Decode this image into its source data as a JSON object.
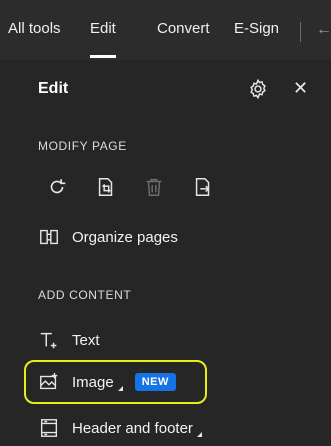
{
  "tabs": [
    {
      "label": "All tools"
    },
    {
      "label": "Edit"
    },
    {
      "label": "Convert"
    },
    {
      "label": "E-Sign"
    }
  ],
  "panel": {
    "title": "Edit",
    "modify_page": {
      "label": "MODIFY PAGE",
      "organize_label": "Organize pages"
    },
    "add_content": {
      "label": "ADD CONTENT",
      "items": [
        {
          "label": "Text"
        },
        {
          "label": "Image",
          "badge": "NEW"
        },
        {
          "label": "Header and footer"
        }
      ]
    }
  },
  "colors": {
    "accent": "#1473e6",
    "highlight": "#e8ee1a"
  },
  "icons": [
    "gear-icon",
    "close-icon",
    "rotate-icon",
    "crop-icon",
    "delete-icon",
    "extract-icon",
    "organize-pages-icon",
    "text-icon",
    "image-icon",
    "header-footer-icon",
    "back-arrow-icon"
  ]
}
